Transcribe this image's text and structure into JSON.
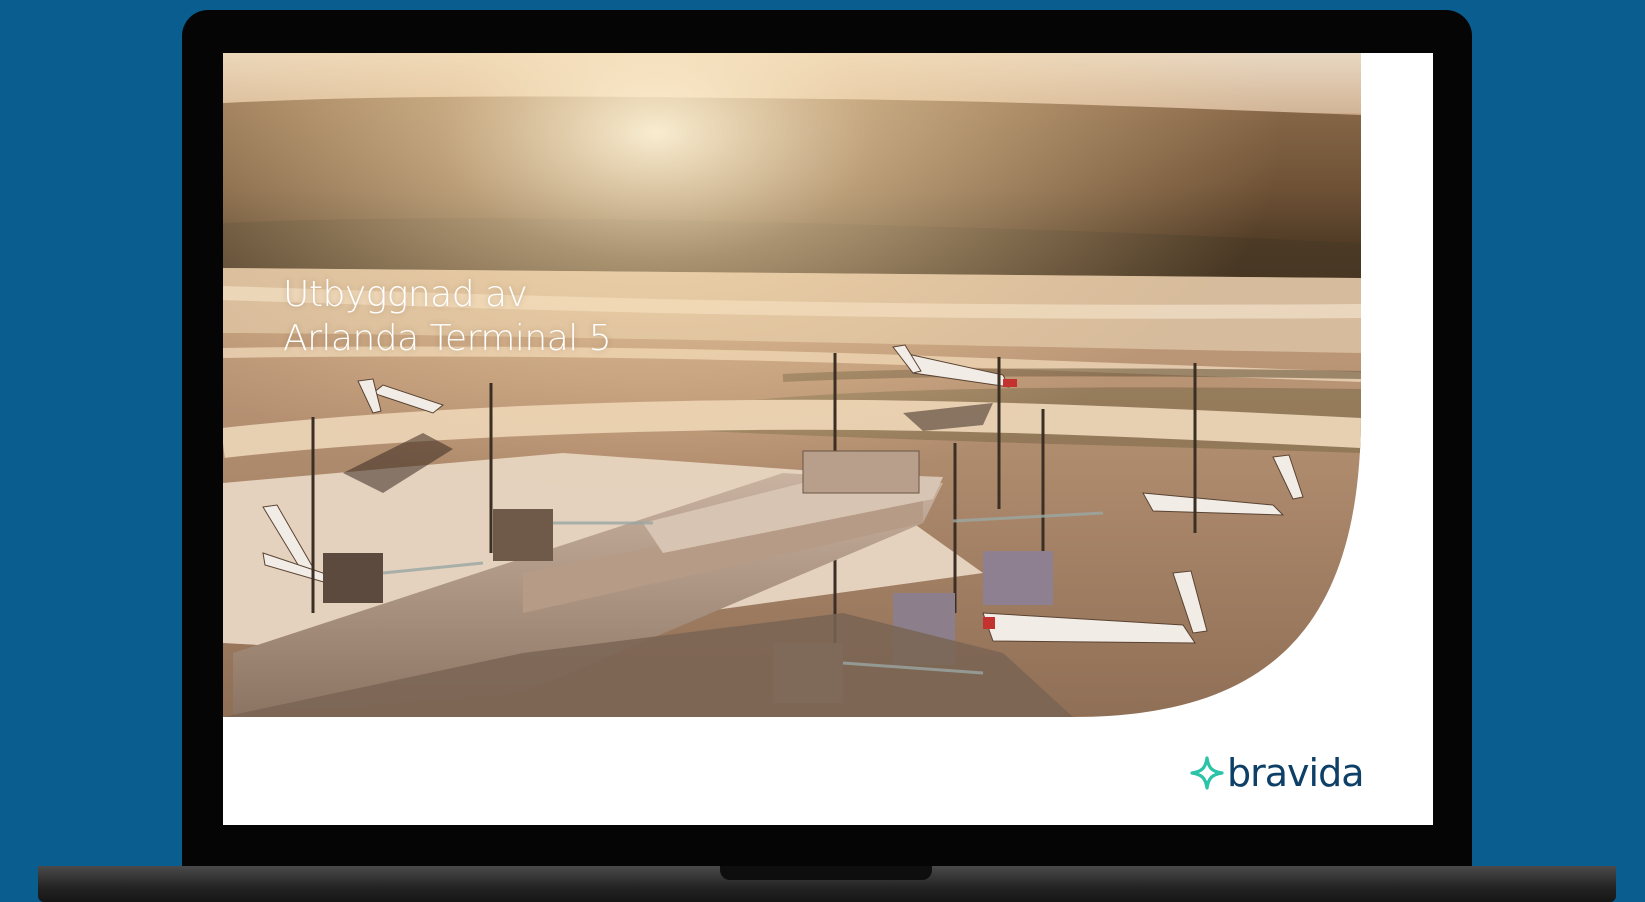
{
  "slide": {
    "title_line1": "Utbyggnad av",
    "title_line2": "Arlanda Terminal 5",
    "brand_name": "bravida"
  },
  "photo": {
    "subject": "aerial-airport-terminal",
    "tone": "warm-sunset"
  },
  "colors": {
    "background": "#0a5d8f",
    "laptop_frame": "#050505",
    "slide_background": "#ffffff",
    "title_text": "#ffffff",
    "brand_wordmark": "#0d3f67",
    "brand_mark": "#2bc4a8"
  },
  "icons": {
    "brand_mark": "bravida-star-icon"
  }
}
